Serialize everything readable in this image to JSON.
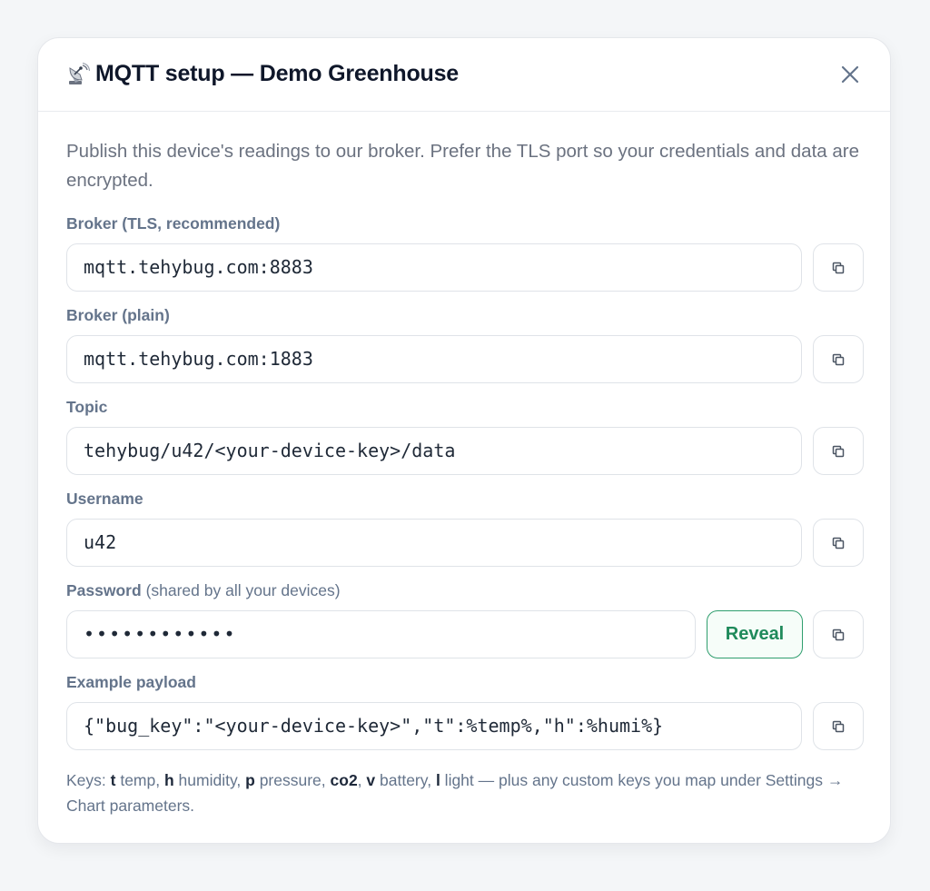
{
  "dialog": {
    "title": "MQTT setup — Demo Greenhouse",
    "title_icon": "satellite-antenna-icon",
    "close_icon": "close-icon",
    "intro": "Publish this device's readings to our broker. Prefer the TLS port so your credentials and data are encrypted."
  },
  "fields": {
    "broker_tls": {
      "label": "Broker (TLS, recommended)",
      "value": "mqtt.tehybug.com:8883"
    },
    "broker_plain": {
      "label": "Broker (plain)",
      "value": "mqtt.tehybug.com:1883"
    },
    "topic": {
      "label": "Topic",
      "value": "tehybug/u42/<your-device-key>/data"
    },
    "username": {
      "label": "Username",
      "value": "u42"
    },
    "password": {
      "label": "Password",
      "sublabel": "(shared by all your devices)",
      "value": "••••••••••••",
      "reveal_label": "Reveal"
    },
    "payload": {
      "label": "Example payload",
      "value": "{\"bug_key\":\"<your-device-key>\",\"t\":%temp%,\"h\":%humi%}"
    }
  },
  "footnote": {
    "prefix": "Keys: ",
    "keys": [
      {
        "key": "t",
        "desc": " temp, "
      },
      {
        "key": "h",
        "desc": " humidity, "
      },
      {
        "key": "p",
        "desc": " pressure, "
      },
      {
        "key": "co2",
        "desc": ", "
      },
      {
        "key": "v",
        "desc": " battery, "
      },
      {
        "key": "l",
        "desc": " light"
      }
    ],
    "suffix": " — plus any custom keys you map under Settings → Chart parameters."
  },
  "icons": {
    "copy": "copy-icon"
  },
  "colors": {
    "accent_green": "#1f8a5b",
    "label_gray": "#64748b",
    "title": "#0f172a"
  }
}
